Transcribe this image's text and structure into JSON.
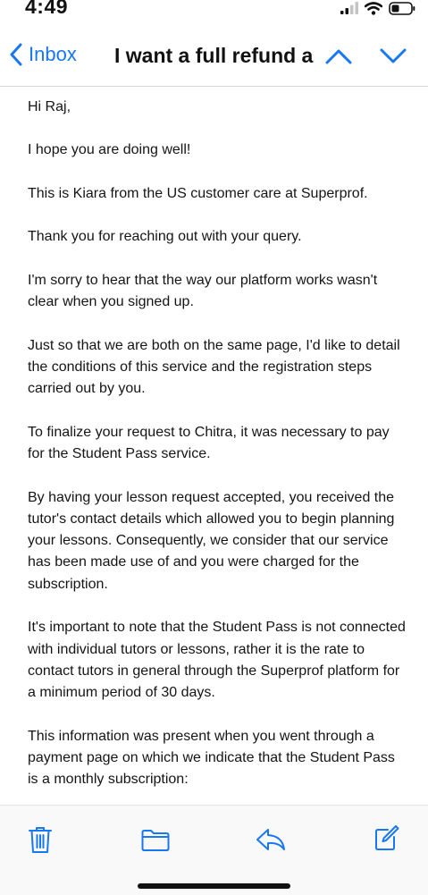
{
  "status_bar": {
    "time": "4:49"
  },
  "nav": {
    "back_label": "Inbox",
    "title": "I want a full refund a..."
  },
  "email": {
    "paragraphs": [
      "Hi Raj,",
      "I hope you are doing well!",
      "This is Kiara from the US customer care at Superprof.",
      "Thank you for reaching out with your query.",
      "I'm sorry to hear that the way our platform works wasn't clear when you signed up.",
      "Just so that we are both on the same page, I'd like to detail the conditions of this service and the registration steps carried out by you.",
      "To finalize your request to Chitra, it was necessary to pay for the Student Pass service.",
      "By having your lesson request accepted, you received the tutor's contact details which allowed you to begin planning your lessons. Consequently, we consider that our service has been made use of and you were charged for the subscription.",
      "It's important to note that the Student Pass is not connected with individual tutors or lessons, rather it is the rate to contact tutors in general through the Superprof platform for a minimum period of 30 days.",
      "This information was present when you went through a payment page on which we indicate that the Student Pass is a monthly subscription:"
    ]
  },
  "colors": {
    "accent": "#1877f2"
  },
  "icons": {
    "toolbar": [
      "trash-icon",
      "folder-icon",
      "reply-icon",
      "compose-icon"
    ],
    "status": [
      "signal-icon",
      "wifi-icon",
      "battery-icon"
    ],
    "nav": [
      "chevron-left-icon",
      "chevron-up-icon",
      "chevron-down-icon"
    ]
  }
}
